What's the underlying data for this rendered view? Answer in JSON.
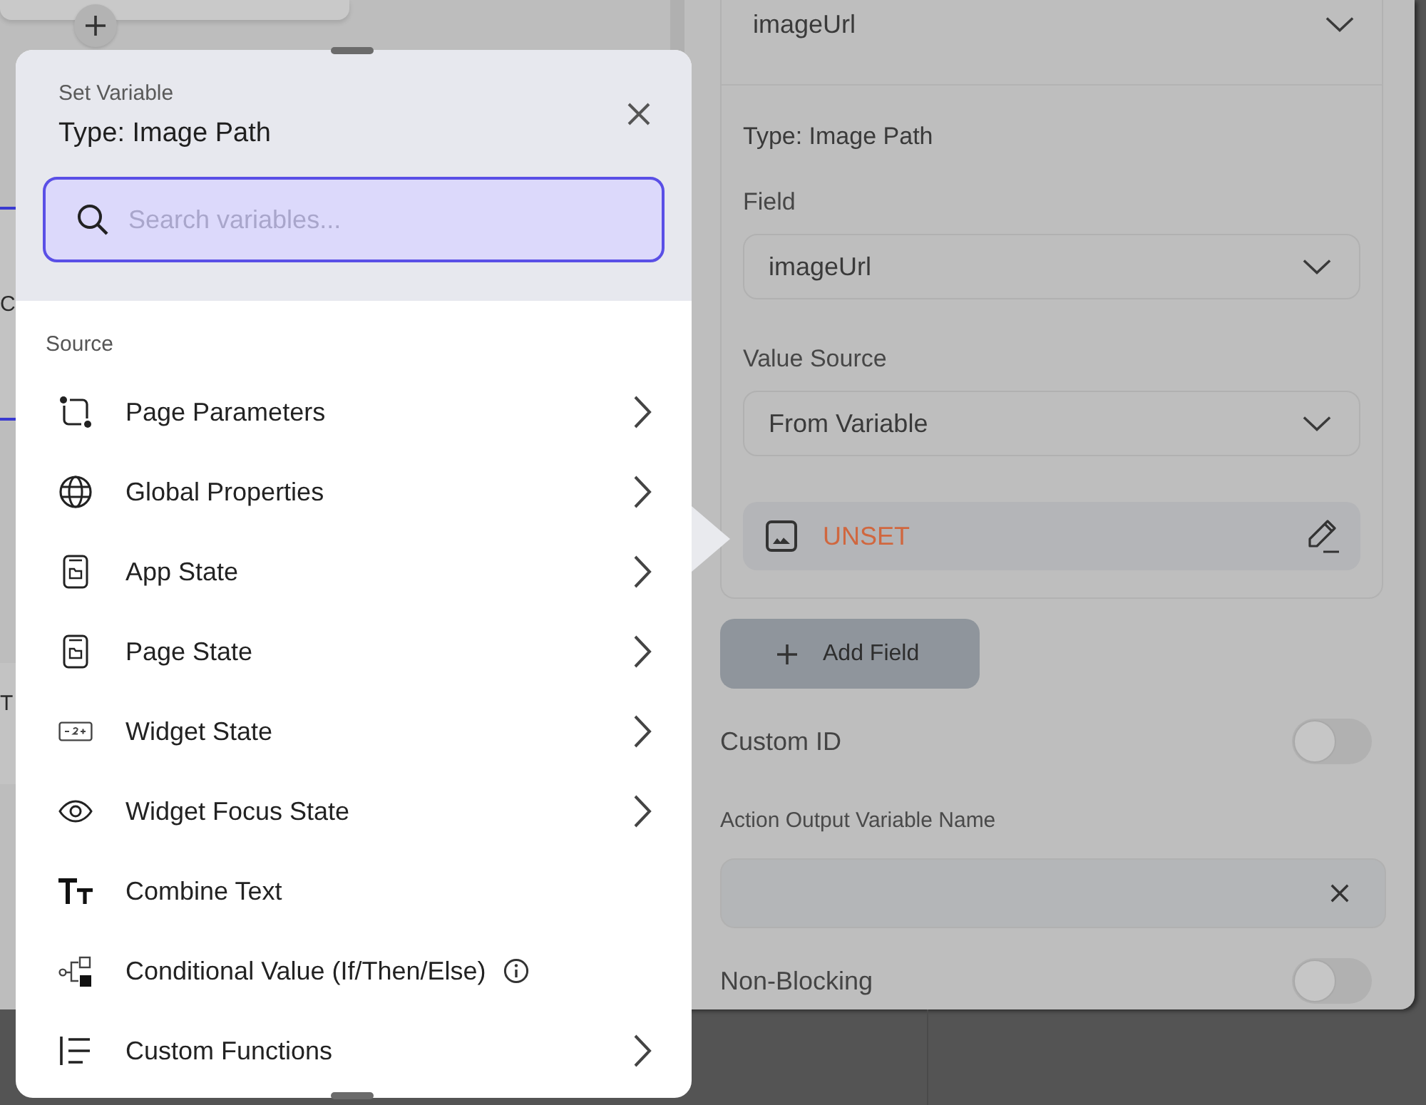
{
  "canvas": {
    "cards": [
      {
        "text": "C",
        "selected": true
      },
      {
        "text": "T",
        "selected": false
      }
    ]
  },
  "popup": {
    "subtitle": "Set Variable",
    "title": "Type: Image Path",
    "search": {
      "placeholder": "Search variables..."
    },
    "section": "Source",
    "items": [
      {
        "label": "Page Parameters",
        "submenu": true,
        "info": false
      },
      {
        "label": "Global Properties",
        "submenu": true,
        "info": false
      },
      {
        "label": "App State",
        "submenu": true,
        "info": false
      },
      {
        "label": "Page State",
        "submenu": true,
        "info": false
      },
      {
        "label": "Widget State",
        "submenu": true,
        "info": false
      },
      {
        "label": "Widget Focus State",
        "submenu": true,
        "info": false
      },
      {
        "label": "Combine Text",
        "submenu": false,
        "info": false
      },
      {
        "label": "Conditional Value (If/Then/Else)",
        "submenu": false,
        "info": true
      },
      {
        "label": "Custom Functions",
        "submenu": true,
        "info": false
      }
    ]
  },
  "panel": {
    "header_dropdown": {
      "value": "imageUrl"
    },
    "field_config": {
      "type_label": "Type: Image Path",
      "field": {
        "label": "Field",
        "value": "imageUrl"
      },
      "value_source": {
        "label": "Value Source",
        "value": "From Variable"
      },
      "variable": {
        "value": "UNSET"
      }
    },
    "add_button": "Add Field",
    "settings": [
      {
        "kind": "toggle",
        "label": "Custom ID",
        "on": false
      },
      {
        "kind": "text_input",
        "label": "Action Output Variable Name"
      },
      {
        "kind": "toggle",
        "label": "Non-Blocking",
        "on": false
      }
    ]
  }
}
